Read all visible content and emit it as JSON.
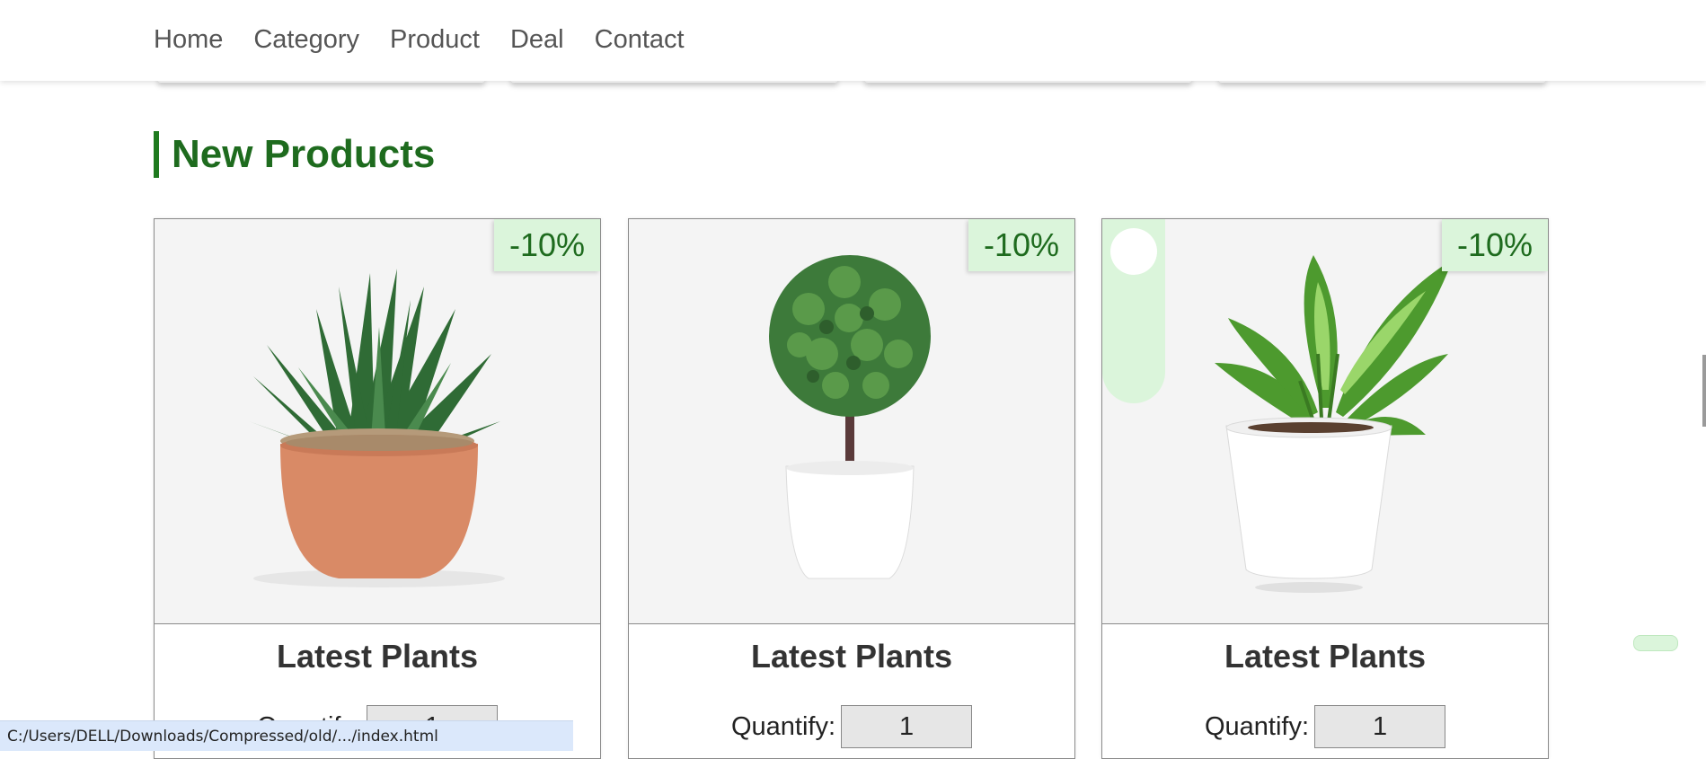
{
  "nav": {
    "items": [
      {
        "label": "Home"
      },
      {
        "label": "Category"
      },
      {
        "label": "Product"
      },
      {
        "label": "Deal"
      },
      {
        "label": "Contact"
      }
    ]
  },
  "section": {
    "title": "New Products"
  },
  "products": [
    {
      "badge": "-10%",
      "title": "Latest Plants",
      "qty_label": "Quantify:",
      "qty_value": "1",
      "image": "succulent-plant-in-terracotta-pot"
    },
    {
      "badge": "-10%",
      "title": "Latest Plants",
      "qty_label": "Quantify:",
      "qty_value": "1",
      "image": "topiary-ball-plant-in-white-pot"
    },
    {
      "badge": "-10%",
      "title": "Latest Plants",
      "qty_label": "Quantify:",
      "qty_value": "1",
      "image": "dieffenbachia-plant-in-white-pot"
    }
  ],
  "status_bar": {
    "text": "C:/Users/DELL/Downloads/Compressed/old/.../index.html"
  },
  "colors": {
    "accent_green": "#1e6b1e",
    "badge_bg": "#dbf5db",
    "image_bg": "#f4f4f4"
  }
}
